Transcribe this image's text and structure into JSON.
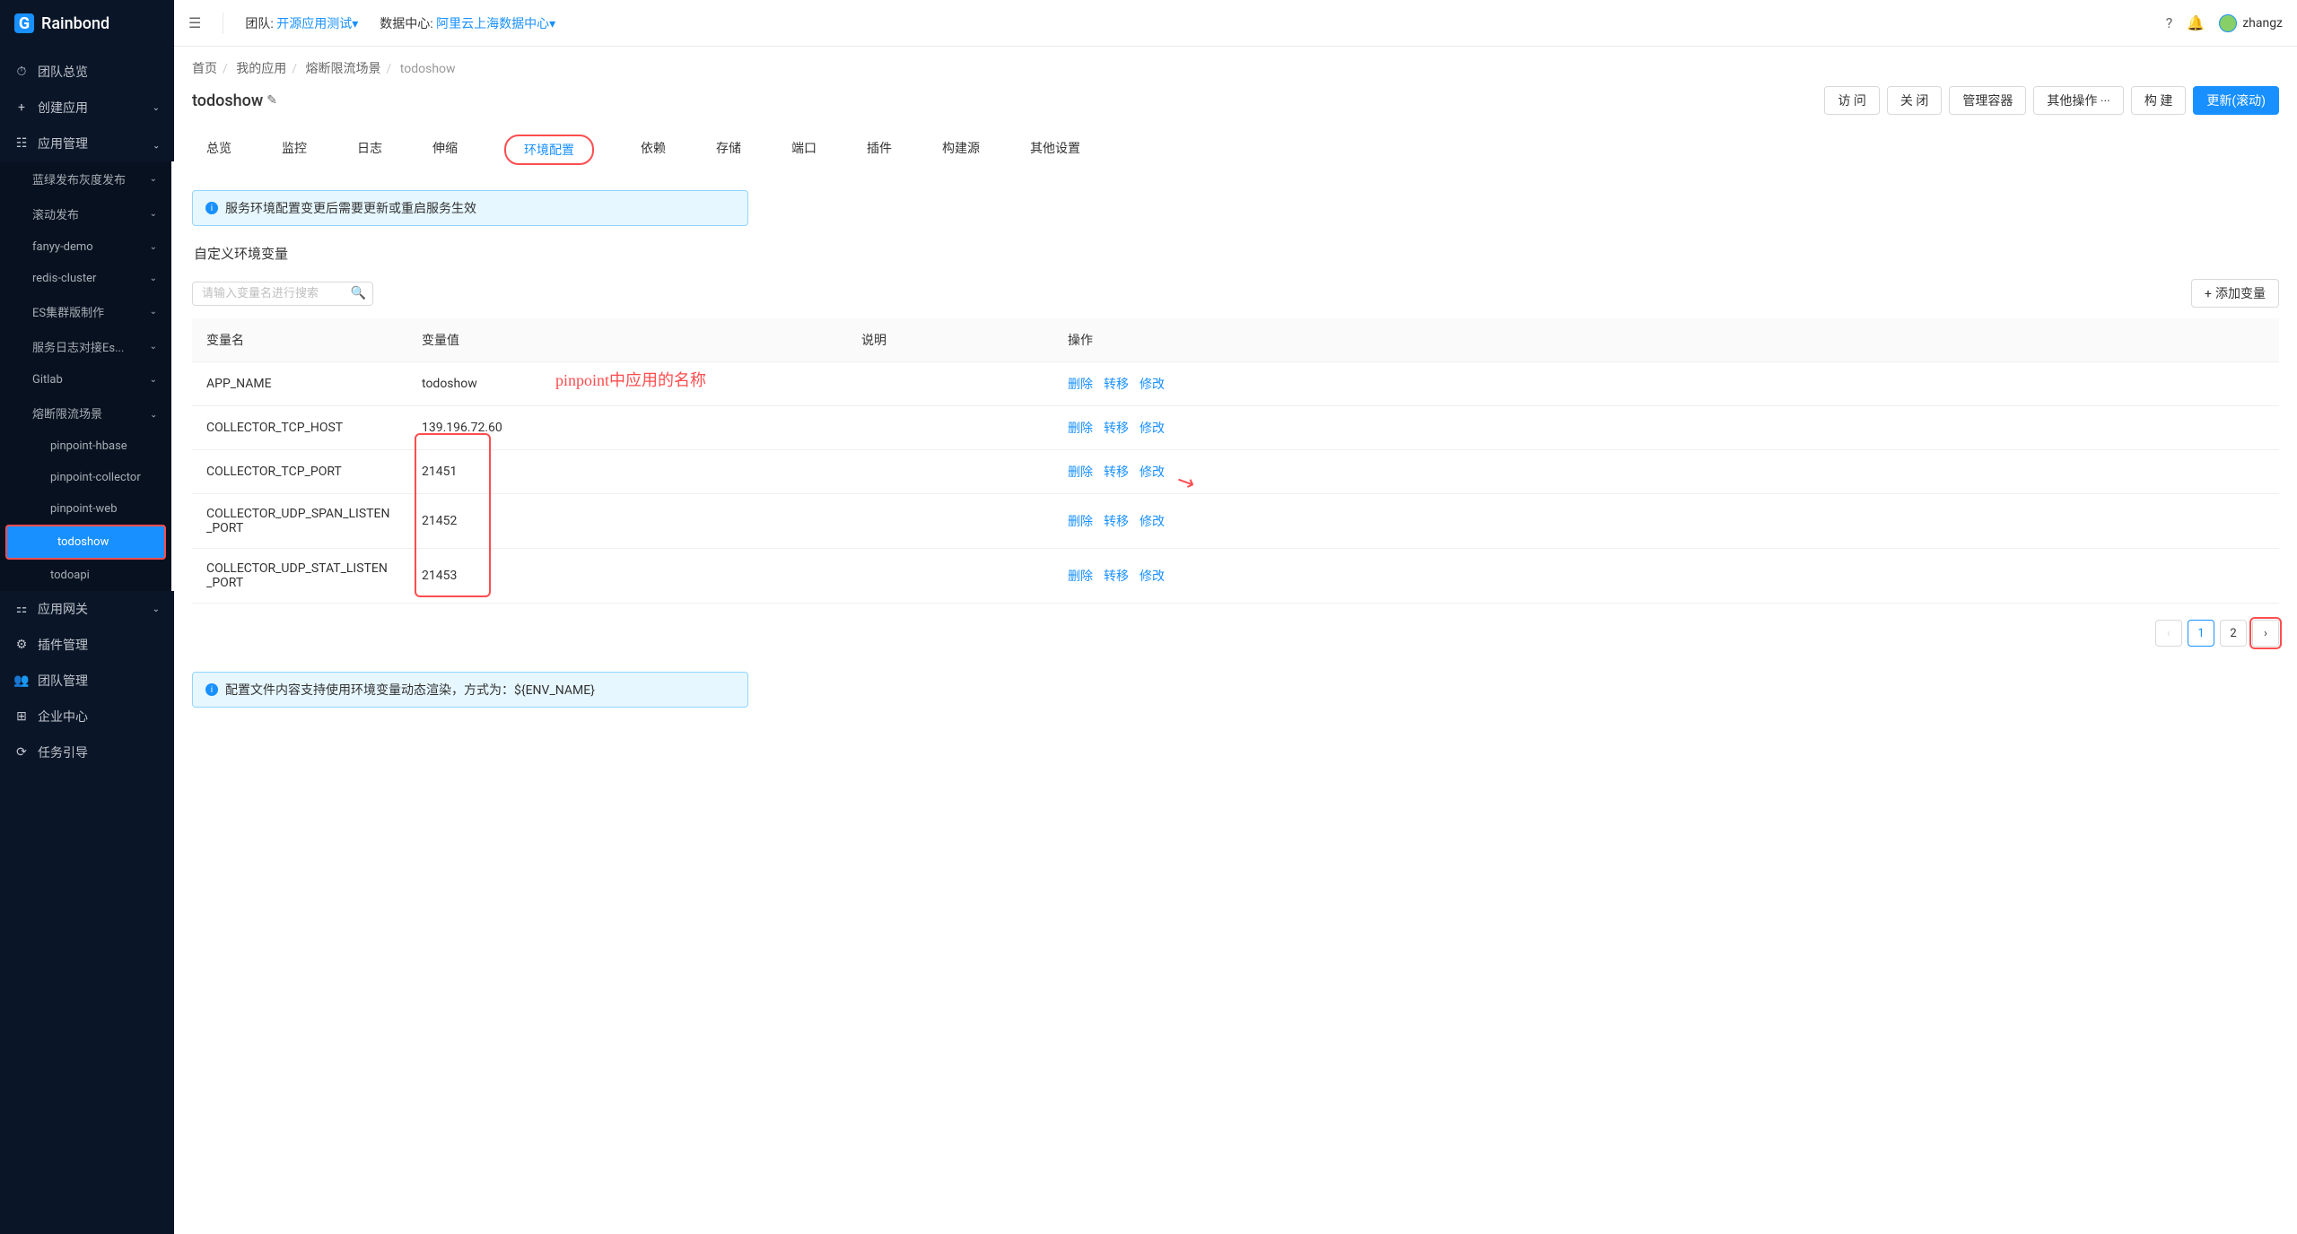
{
  "brand": "Rainbond",
  "topbar": {
    "team_label": "团队:",
    "team_value": "开源应用测试",
    "dc_label": "数据中心:",
    "dc_value": "阿里云上海数据中心",
    "dropdown_caret": "▾",
    "username": "zhangz"
  },
  "sidebar": {
    "items": [
      {
        "icon": "⏱",
        "label": "团队总览"
      },
      {
        "icon": "+",
        "label": "创建应用",
        "has_children": true
      },
      {
        "icon": "☷",
        "label": "应用管理",
        "has_children": true,
        "expanded": true
      }
    ],
    "app_subitems": [
      {
        "label": "蓝绿发布灰度发布",
        "has_children": true
      },
      {
        "label": "滚动发布",
        "has_children": true
      },
      {
        "label": "fanyy-demo",
        "has_children": true
      },
      {
        "label": "redis-cluster",
        "has_children": true
      },
      {
        "label": "ES集群版制作",
        "has_children": true
      },
      {
        "label": "服务日志对接Es...",
        "has_children": true
      },
      {
        "label": "Gitlab",
        "has_children": true
      },
      {
        "label": "熔断限流场景",
        "has_children": true,
        "expanded": true
      }
    ],
    "scenario_children": [
      {
        "label": "pinpoint-hbase"
      },
      {
        "label": "pinpoint-collector"
      },
      {
        "label": "pinpoint-web"
      },
      {
        "label": "todoshow",
        "active": true,
        "redmark": true
      },
      {
        "label": "todoapi"
      }
    ],
    "bottom_items": [
      {
        "icon": "⚏",
        "label": "应用网关",
        "has_children": true
      },
      {
        "icon": "⚙",
        "label": "插件管理"
      },
      {
        "icon": "👥",
        "label": "团队管理"
      },
      {
        "icon": "⊞",
        "label": "企业中心"
      },
      {
        "icon": "⟳",
        "label": "任务引导"
      }
    ]
  },
  "breadcrumb": [
    "首页",
    "我的应用",
    "熔断限流场景",
    "todoshow"
  ],
  "page_title": "todoshow",
  "actions": {
    "visit": "访 问",
    "close": "关 闭",
    "manage_container": "管理容器",
    "other_ops": "其他操作  ···",
    "build": "构 建",
    "update_rolling": "更新(滚动)"
  },
  "tabs": [
    "总览",
    "监控",
    "日志",
    "伸缩",
    "环境配置",
    "依赖",
    "存储",
    "端口",
    "插件",
    "构建源",
    "其他设置"
  ],
  "active_tab": "环境配置",
  "alert1": "服务环境配置变更后需要更新或重启服务生效",
  "custom_env_title": "自定义环境变量",
  "search_placeholder": "请输入变量名进行搜索",
  "add_var_btn": "添加变量",
  "columns": {
    "name": "变量名",
    "value": "变量值",
    "desc": "说明",
    "ops": "操作"
  },
  "env_rows": [
    {
      "name": "APP_NAME",
      "value": "todoshow",
      "desc": ""
    },
    {
      "name": "COLLECTOR_TCP_HOST",
      "value": "139.196.72.60",
      "desc": ""
    },
    {
      "name": "COLLECTOR_TCP_PORT",
      "value": "21451",
      "desc": ""
    },
    {
      "name": "COLLECTOR_UDP_SPAN_LISTEN_PORT",
      "value": "21452",
      "desc": ""
    },
    {
      "name": "COLLECTOR_UDP_STAT_LISTEN_PORT",
      "value": "21453",
      "desc": ""
    }
  ],
  "row_actions": {
    "delete": "删除",
    "transfer": "转移",
    "modify": "修改"
  },
  "annotation1": "pinpoint中应用的名称",
  "pagination": {
    "pages": [
      "1",
      "2"
    ],
    "active": "1"
  },
  "alert2": "配置文件内容支持使用环境变量动态渲染，方式为：${ENV_NAME}"
}
